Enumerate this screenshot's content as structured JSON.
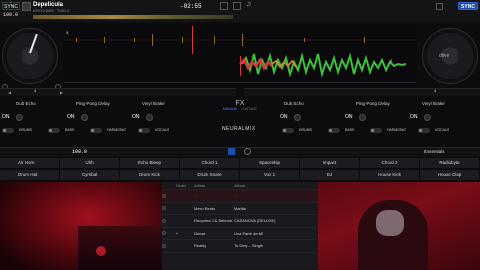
{
  "deck_left": {
    "sync_label": "SYNC",
    "bpm": "100.0",
    "key_hint": "0.0",
    "track_title": "Depelicula",
    "track_artist": "KIROCHARD · TISELO",
    "time_remaining": "-02:55",
    "cue_count": "3",
    "loop_label": "4",
    "tempo_label": "100.0"
  },
  "deck_right": {
    "sync_label": "SYNC",
    "track_hint": "dlive",
    "cue_count": "2",
    "loop_label": "4"
  },
  "fx": {
    "title": "FX",
    "manual_label": "MANUAL",
    "instant_label": "INSTANT",
    "neuralmix_label": "NEURALMIX",
    "left_units": [
      {
        "name": "Dub Echo",
        "on": "ON"
      },
      {
        "name": "Ping-Pong Delay",
        "on": "ON"
      },
      {
        "name": "Vinyl Brake",
        "on": "ON"
      }
    ],
    "right_units": [
      {
        "name": "Dub Echo",
        "on": "ON"
      },
      {
        "name": "Ping-Pong Delay",
        "on": "ON"
      },
      {
        "name": "Vinyl Brake",
        "on": "ON"
      }
    ],
    "left_stems": [
      "DRUMS",
      "BASS",
      "HARMONIC",
      "VOCALS"
    ],
    "right_stems": [
      "DRUMS",
      "BASS",
      "HARMONIC",
      "VOCALS"
    ],
    "essentials_label": "Essentials"
  },
  "sampler": {
    "row1": [
      "Air Horn",
      "Uhh",
      "Echo Bleep",
      "Chord 1",
      "Spaceship",
      "Impact",
      "Chord 2",
      "Radiobyte"
    ],
    "row2": [
      "Drum Hat",
      "Cymbal",
      "Drum Kick",
      "Drum Snare",
      "Vox 1",
      "DJ",
      "House Kick",
      "House Clap"
    ]
  },
  "library": {
    "columns": [
      "Order",
      "Artists",
      "Album"
    ],
    "rows": [
      {
        "artist": "…",
        "album": "…"
      },
      {
        "artist": "Mexo Beats",
        "album": "Marilla"
      },
      {
        "artist": "Recycled J & Selecta",
        "album": "CASANOVA (DELUXE)"
      },
      {
        "artist": "Dense",
        "album": "Una Parte de Mi"
      },
      {
        "artist": "Reality",
        "album": "To Dirty – Single"
      }
    ]
  },
  "colors": {
    "accent_blue": "#1f4ea8",
    "waveform_red": "#d6393b",
    "waveform_green": "#3fbf3f",
    "waveform_orange": "#d88a2a",
    "video_red": "#7a0d14"
  }
}
